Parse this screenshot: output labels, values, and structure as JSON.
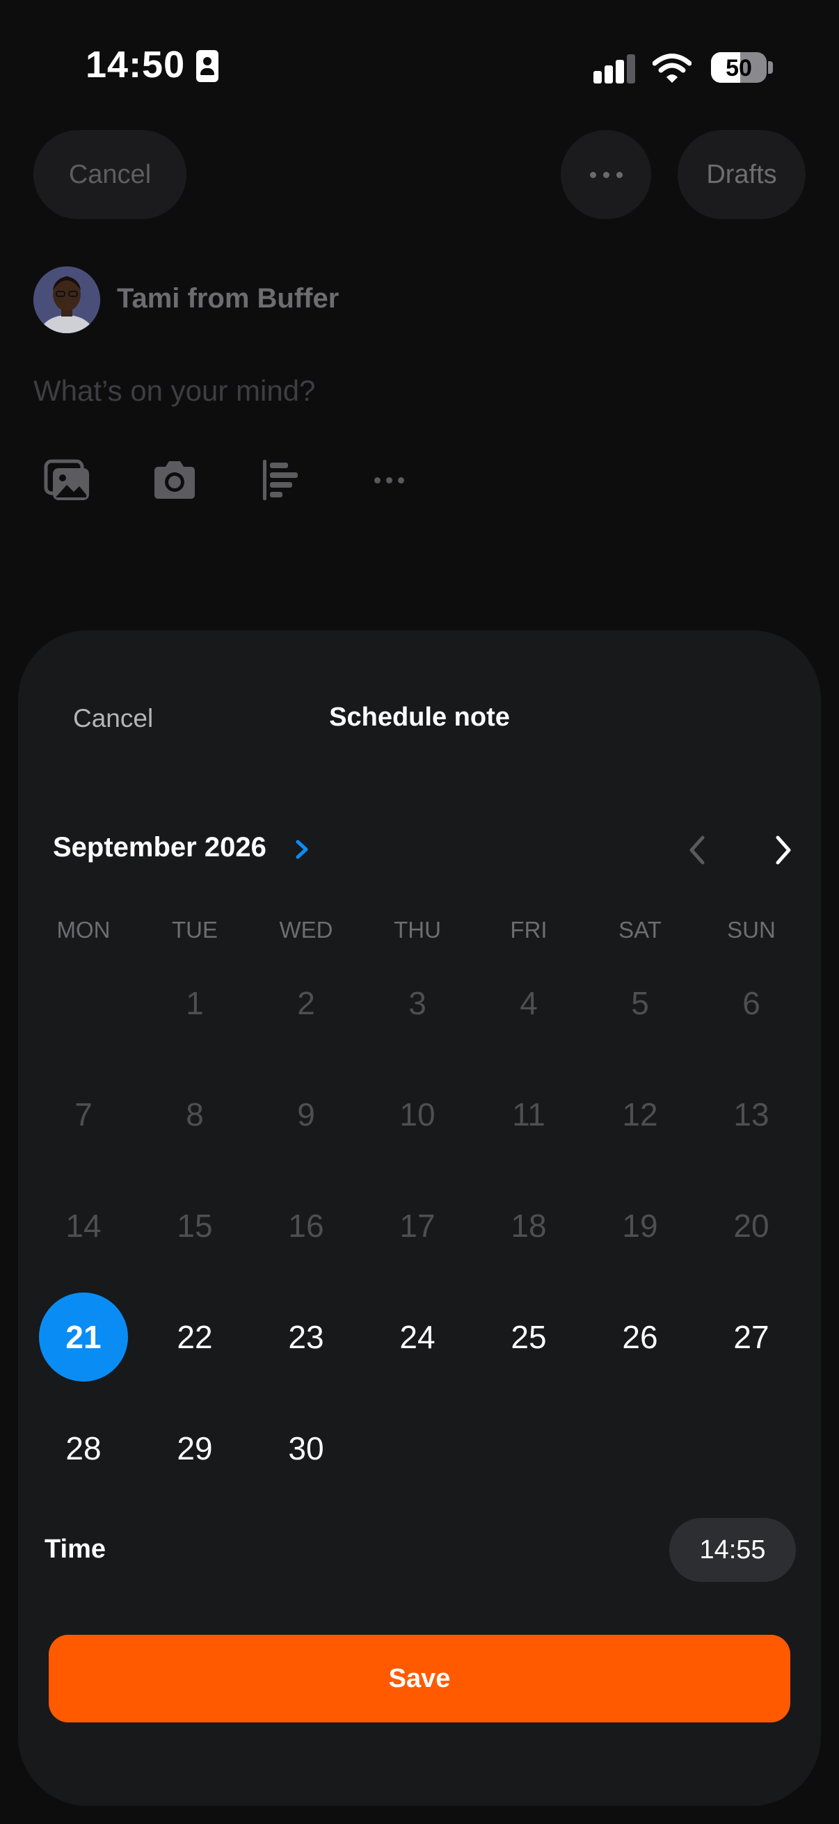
{
  "status_bar": {
    "time": "14:50",
    "battery": "50"
  },
  "composer": {
    "cancel_label": "Cancel",
    "drafts_label": "Drafts",
    "author_name": "Tami from Buffer",
    "placeholder": "What’s on your mind?"
  },
  "schedule_sheet": {
    "cancel_label": "Cancel",
    "title": "Schedule note",
    "month_label": "September 2026",
    "weekdays": [
      "MON",
      "TUE",
      "WED",
      "THU",
      "FRI",
      "SAT",
      "SUN"
    ],
    "days": [
      "1",
      "2",
      "3",
      "4",
      "5",
      "6",
      "7",
      "8",
      "9",
      "10",
      "11",
      "12",
      "13",
      "14",
      "15",
      "16",
      "17",
      "18",
      "19",
      "20",
      "21",
      "22",
      "23",
      "24",
      "25",
      "26",
      "27",
      "28",
      "29",
      "30"
    ],
    "first_weekday_index": 1,
    "first_available_day": 21,
    "selected_day": 21,
    "time_label": "Time",
    "time_value": "14:55",
    "save_label": "Save"
  },
  "colors": {
    "accent_blue": "#0a8cf5",
    "save_orange": "#ff5a00"
  },
  "icons": [
    "id-card-icon",
    "signal-icon",
    "wifi-icon",
    "battery-icon",
    "ellipsis-icon",
    "photo-library-icon",
    "camera-icon",
    "poll-icon",
    "more-icon",
    "chevron-right-icon",
    "chevron-left-icon"
  ]
}
